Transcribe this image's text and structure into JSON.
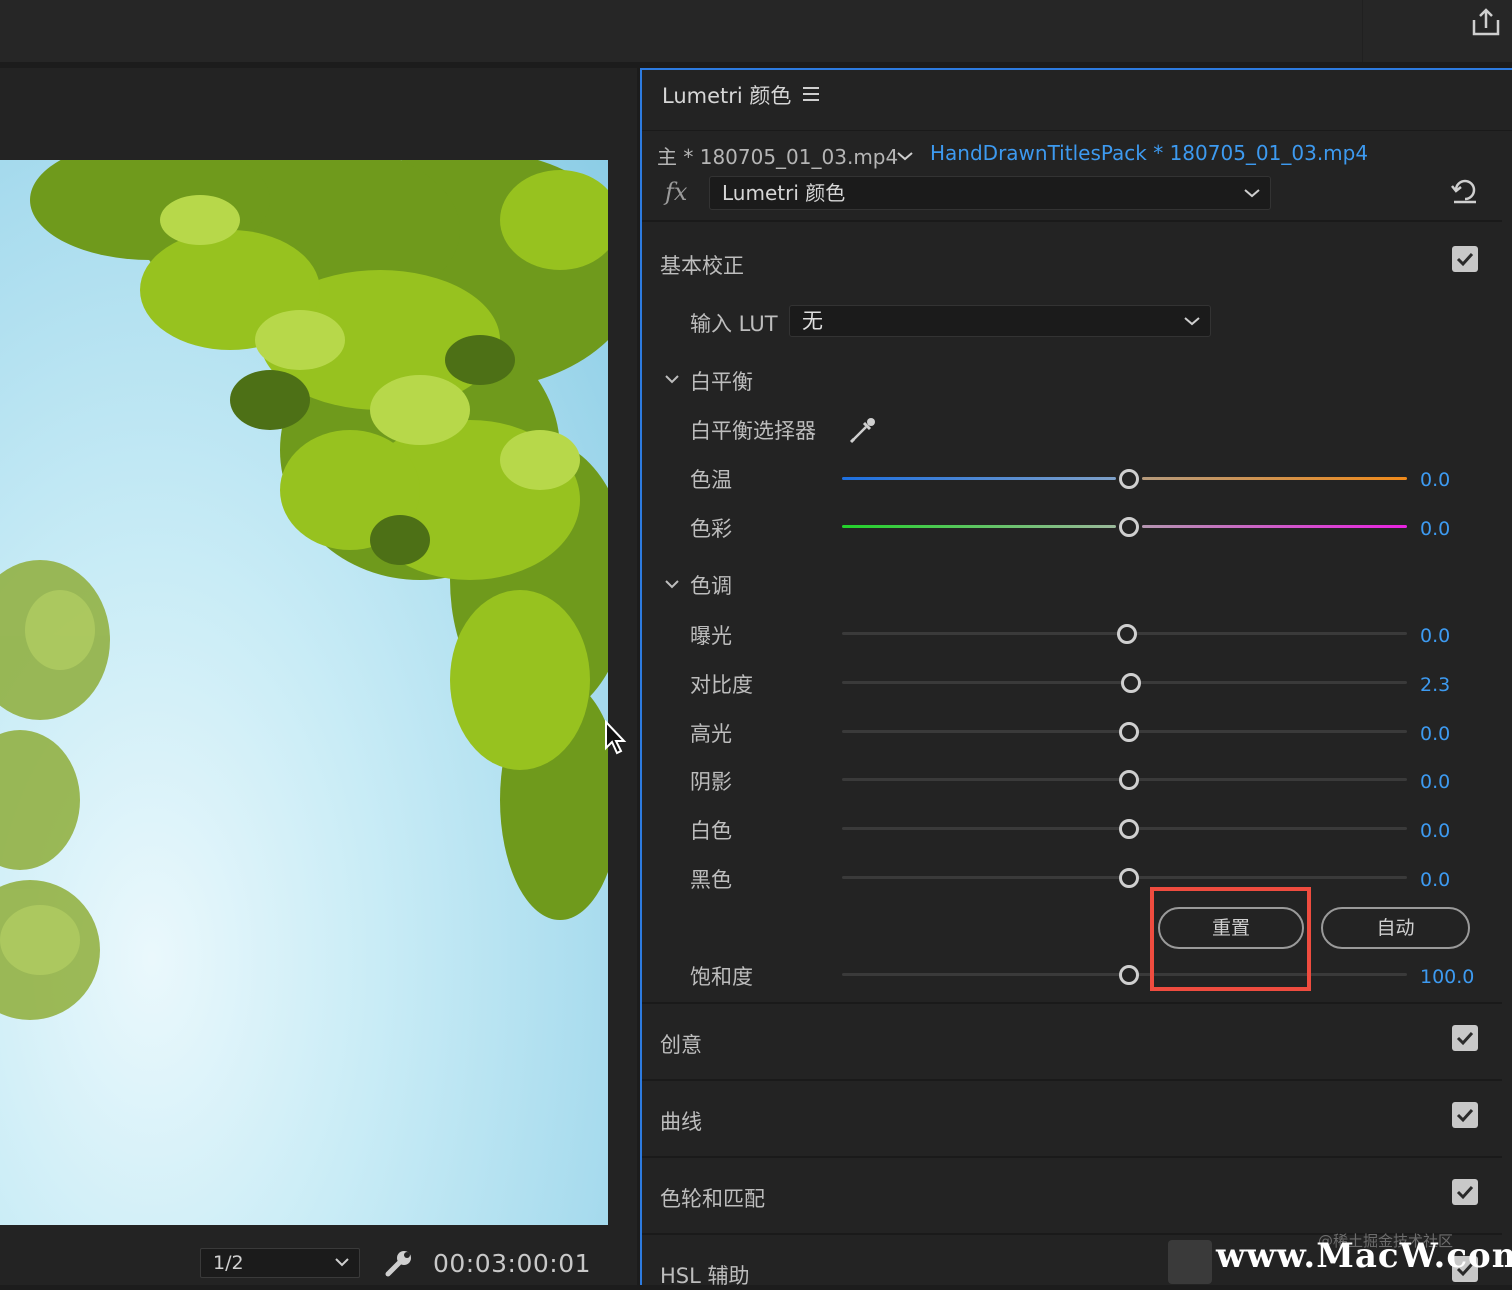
{
  "viewer": {
    "zoom": "1/2",
    "timecode": "00:03:00:01"
  },
  "panel": {
    "title": "Lumetri 颜色",
    "master_clip": "主 * 180705_01_03.mp4",
    "sequence_clip": "HandDrawnTitlesPack * 180705_01_03.mp4",
    "fx_label": "fx",
    "effect": "Lumetri 颜色"
  },
  "basic": {
    "title": "基本校正",
    "enabled": true,
    "input_lut_label": "输入 LUT",
    "input_lut_value": "无",
    "white_balance": {
      "title": "白平衡",
      "picker_label": "白平衡选择器",
      "temperature": {
        "label": "色温",
        "value": "0.0"
      },
      "tint": {
        "label": "色彩",
        "value": "0.0"
      }
    },
    "tone": {
      "title": "色调",
      "exposure": {
        "label": "曝光",
        "value": "0.0"
      },
      "contrast": {
        "label": "对比度",
        "value": "2.3"
      },
      "highlights": {
        "label": "高光",
        "value": "0.0"
      },
      "shadows": {
        "label": "阴影",
        "value": "0.0"
      },
      "whites": {
        "label": "白色",
        "value": "0.0"
      },
      "blacks": {
        "label": "黑色",
        "value": "0.0"
      }
    },
    "reset_label": "重置",
    "auto_label": "自动",
    "saturation": {
      "label": "饱和度",
      "value": "100.0"
    }
  },
  "sections": [
    {
      "title": "创意",
      "enabled": true
    },
    {
      "title": "曲线",
      "enabled": true
    },
    {
      "title": "色轮和匹配",
      "enabled": true
    },
    {
      "title": "HSL 辅助",
      "enabled": true
    }
  ],
  "watermark": {
    "small": "@稀土掘金技术社区",
    "large": "www.MacW.com"
  },
  "colors": {
    "accent": "#3d9af0",
    "highlight": "#ef4c3f",
    "panel_border": "#2d7be0"
  }
}
